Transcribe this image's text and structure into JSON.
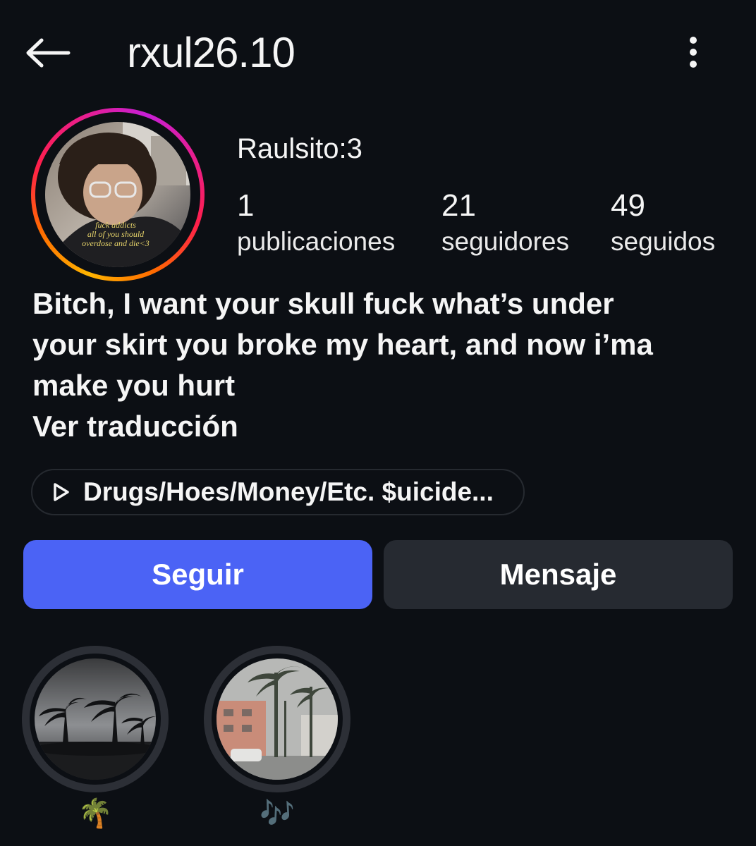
{
  "header": {
    "back_icon": "arrow-left-icon",
    "username": "rxul26.10",
    "more_icon": "more-vertical-icon"
  },
  "profile": {
    "display_name": "Raulsito:3",
    "avatar_caption": [
      "fuck addicts",
      "all of you should",
      "overdose and die<3"
    ],
    "stats": {
      "posts": {
        "value": "1",
        "label": "publicaciones"
      },
      "followers": {
        "value": "21",
        "label": "seguidores"
      },
      "following": {
        "value": "49",
        "label": "seguidos"
      }
    },
    "bio_lines": [
      "Bitch, I want your skull fuck what’s under",
      "your skirt you broke my heart, and now i’ma",
      "make you hurt"
    ],
    "translate_label": "Ver traducción",
    "music": {
      "icon": "play-outline-icon",
      "text": "Drugs/Hoes/Money/Etc. $uicide..."
    }
  },
  "actions": {
    "follow_label": "Seguir",
    "message_label": "Mensaje",
    "follow_color": "#4b63f5",
    "message_color": "#262a31"
  },
  "highlights": [
    {
      "label": "🌴"
    },
    {
      "label": "🎶"
    }
  ],
  "theme": {
    "background": "#0c0f14",
    "text": "#f5f5f5",
    "ring_gradient": [
      "#ffb500",
      "#ff1f4b",
      "#c71fd6"
    ]
  }
}
